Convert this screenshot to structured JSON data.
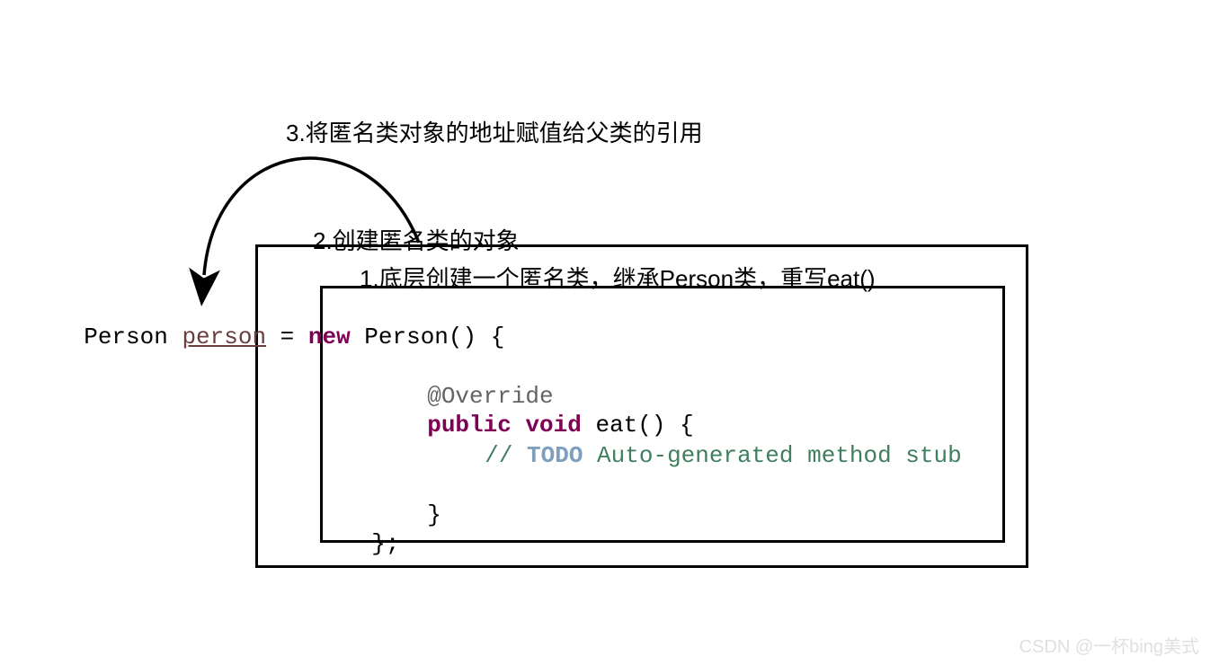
{
  "labels": {
    "step3": "3.将匿名类对象的地址赋值给父类的引用",
    "step2": "2.创建匿名类的对象",
    "step1": "1.底层创建一个匿名类，继承Person类，重写eat()"
  },
  "code": {
    "line1_class": "Person ",
    "line1_var": "person",
    "line1_eq": " = ",
    "line1_new": "new",
    "line1_rest": " Person() {",
    "override": "@Override",
    "public": "public",
    "void": "void",
    "eat_sig": " eat() {",
    "comment_slash": "// ",
    "todo": "TODO",
    "comment_rest": " Auto-generated method stub",
    "brace_close_method": "}",
    "brace_close_class": "};"
  },
  "watermark": "CSDN @一杯bing美式",
  "colors": {
    "keyword": "#7f0055",
    "annotation": "#646464",
    "todo_kw": "#7f9fbf",
    "comment": "#3f7f5f",
    "variable": "#6a3e3e"
  }
}
